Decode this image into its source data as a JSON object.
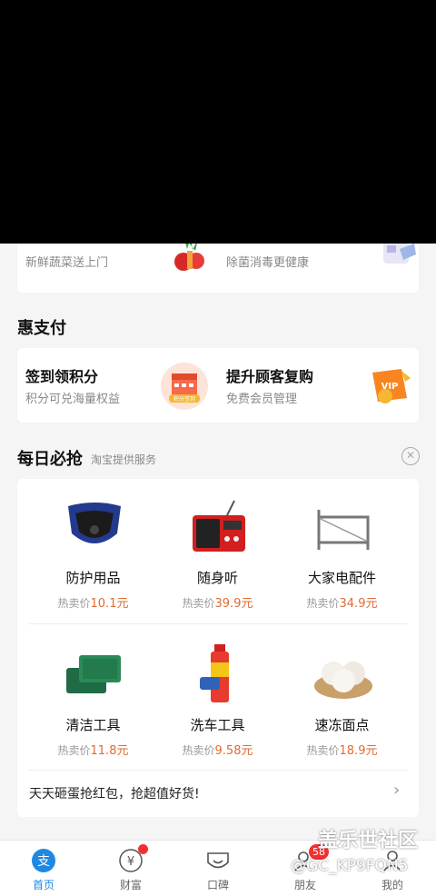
{
  "partial_card": {
    "left_subtitle": "新鲜蔬菜送上门",
    "right_subtitle": "除菌消毒更健康"
  },
  "huizhifu": {
    "title": "惠支付",
    "items": [
      {
        "title": "签到领积分",
        "subtitle": "积分可兑海量权益",
        "icon": "calendar-points-icon",
        "icon_text": "积分签到"
      },
      {
        "title": "提升顾客复购",
        "subtitle": "免费会员管理",
        "icon": "vip-ticket-icon",
        "icon_text": "VIP"
      }
    ]
  },
  "daily": {
    "title": "每日必抢",
    "subtitle": "淘宝提供服务",
    "close_icon": "close-circle-icon",
    "price_prefix": "热卖价",
    "price_suffix": "元",
    "items": [
      {
        "name": "防护用品",
        "price": "10.1",
        "icon": "face-mask-icon"
      },
      {
        "name": "随身听",
        "price": "39.9",
        "icon": "radio-icon"
      },
      {
        "name": "大家电配件",
        "price": "34.9",
        "icon": "bracket-icon"
      },
      {
        "name": "清洁工具",
        "price": "11.8",
        "icon": "scouring-pad-icon"
      },
      {
        "name": "洗车工具",
        "price": "9.58",
        "icon": "spray-can-icon"
      },
      {
        "name": "速冻面点",
        "price": "18.9",
        "icon": "steamed-buns-icon"
      }
    ],
    "promo_text": "天天砸蛋抢红包，抢超值好货!",
    "promo_arrow_icon": "chevron-right-icon"
  },
  "nav": {
    "items": [
      {
        "label": "首页",
        "icon": "alipay-icon",
        "active": true
      },
      {
        "label": "财富",
        "icon": "yuan-icon",
        "badge_dot": true
      },
      {
        "label": "口碑",
        "icon": "koubei-icon"
      },
      {
        "label": "朋友",
        "icon": "friends-icon",
        "badge": "58"
      },
      {
        "label": "我的",
        "icon": "person-icon"
      }
    ]
  },
  "watermark": {
    "title": "盖乐世社区",
    "subtitle": "@GC_KP9FQN5"
  },
  "colors": {
    "accent": "#1e88e5",
    "price": "#e06b32",
    "badge": "#f23030"
  }
}
